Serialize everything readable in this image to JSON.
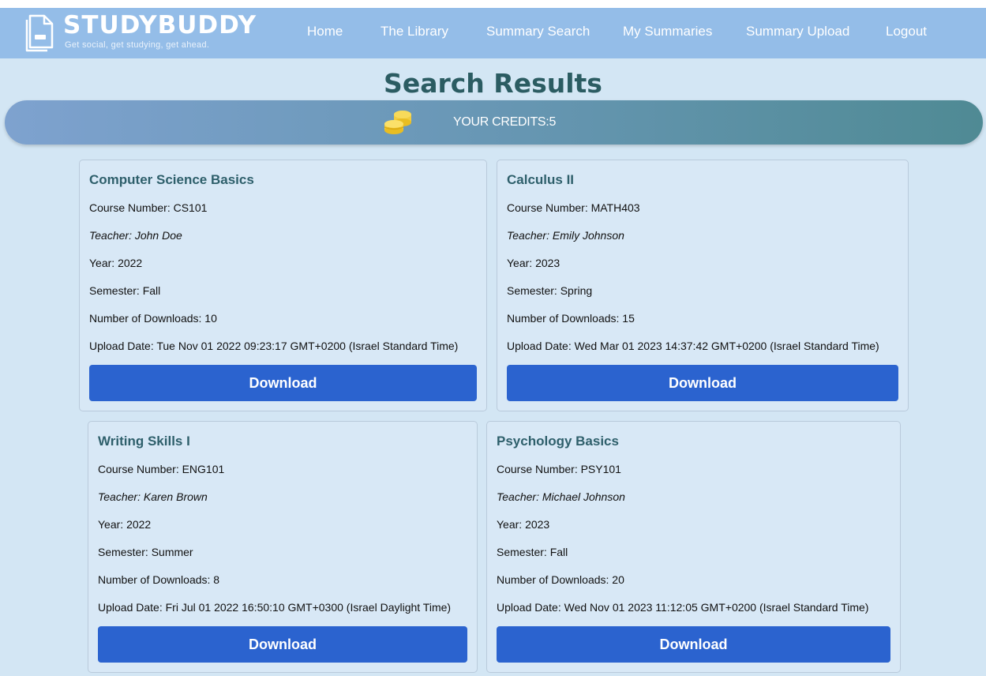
{
  "header": {
    "brand": "STUDYBUDDY",
    "tagline": "Get social, get studying, get ahead.",
    "logo_icon": "document-icon",
    "nav": [
      "Home",
      "The Library",
      "Summary Search",
      "My Summaries",
      "Summary Upload",
      "Logout"
    ]
  },
  "page": {
    "title": "Search Results"
  },
  "credits": {
    "icon": "coins-icon",
    "label": "YOUR CREDITS:5"
  },
  "colors": {
    "header_bg": "#94bde8",
    "background": "#d3e6f4",
    "title": "#2b5c62",
    "button": "#2b63cf"
  },
  "results": [
    {
      "title": "Computer Science Basics",
      "course_number": "Course Number: CS101",
      "teacher": "Teacher: John Doe",
      "year": "Year: 2022",
      "semester": "Semester: Fall",
      "downloads": "Number of Downloads: 10",
      "upload_date": "Upload Date: Tue Nov 01 2022 09:23:17 GMT+0200 (Israel Standard Time)",
      "button": "Download"
    },
    {
      "title": "Calculus II",
      "course_number": "Course Number: MATH403",
      "teacher": "Teacher: Emily Johnson",
      "year": "Year: 2023",
      "semester": "Semester: Spring",
      "downloads": "Number of Downloads: 15",
      "upload_date": "Upload Date: Wed Mar 01 2023 14:37:42 GMT+0200 (Israel Standard Time)",
      "button": "Download"
    },
    {
      "title": "Writing Skills I",
      "course_number": "Course Number: ENG101",
      "teacher": "Teacher: Karen Brown",
      "year": "Year: 2022",
      "semester": "Semester: Summer",
      "downloads": "Number of Downloads: 8",
      "upload_date": "Upload Date: Fri Jul 01 2022 16:50:10 GMT+0300 (Israel Daylight Time)",
      "button": "Download"
    },
    {
      "title": "Psychology Basics",
      "course_number": "Course Number: PSY101",
      "teacher": "Teacher: Michael Johnson",
      "year": "Year: 2023",
      "semester": "Semester: Fall",
      "downloads": "Number of Downloads: 20",
      "upload_date": "Upload Date: Wed Nov 01 2023 11:12:05 GMT+0200 (Israel Standard Time)",
      "button": "Download"
    }
  ]
}
